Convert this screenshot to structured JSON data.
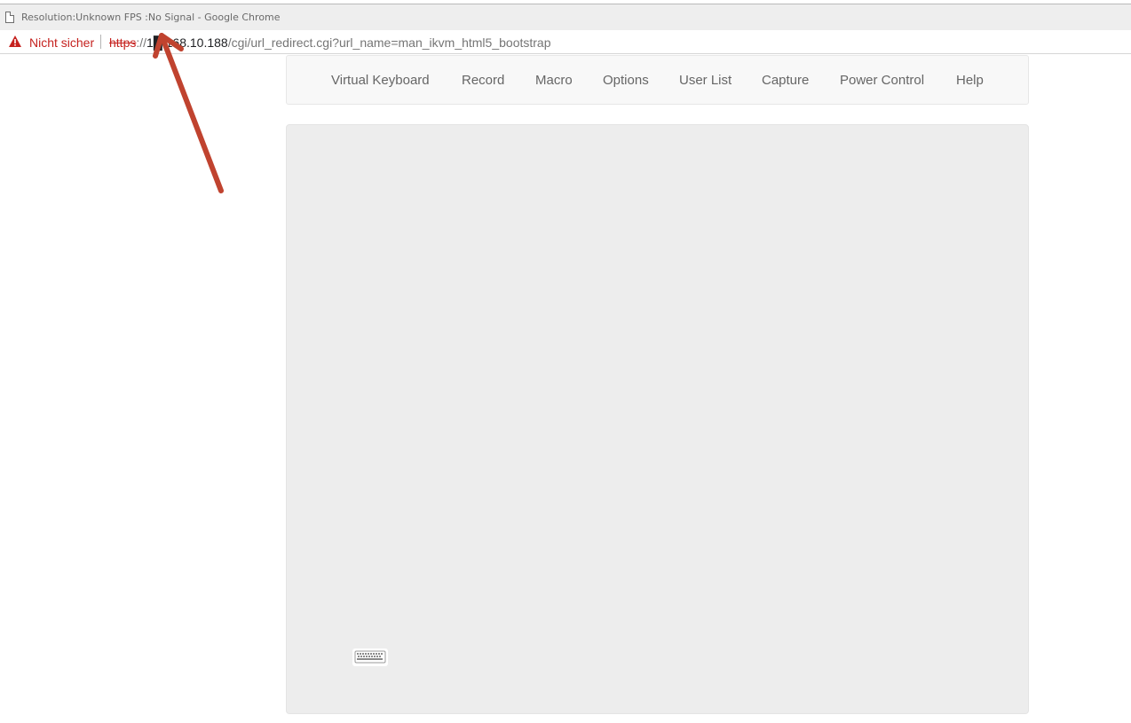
{
  "window": {
    "title": "Resolution:Unknown FPS :No Signal - Google Chrome",
    "page_icon": "document-icon"
  },
  "addressbar": {
    "security_icon": "warning-triangle-icon",
    "security_label": "Nicht sicher",
    "url_scheme": "https",
    "url_sep": "://",
    "url_host": "1█.168.10.188",
    "url_path": "/cgi/url_redirect.cgi?url_name=man_ikvm_html5_bootstrap"
  },
  "navbar": {
    "items": [
      {
        "label": "Virtual Keyboard"
      },
      {
        "label": "Record"
      },
      {
        "label": "Macro"
      },
      {
        "label": "Options"
      },
      {
        "label": "User List"
      },
      {
        "label": "Capture"
      },
      {
        "label": "Power Control"
      },
      {
        "label": "Help"
      }
    ]
  },
  "console": {
    "keyboard_icon": "keyboard-icon"
  },
  "annotation": {
    "arrow_color": "#c0432f"
  },
  "colors": {
    "navbar_bg": "#f8f8f8",
    "nav_text": "#666666",
    "screen_bg": "#ededed",
    "security_red": "#c5221f"
  }
}
